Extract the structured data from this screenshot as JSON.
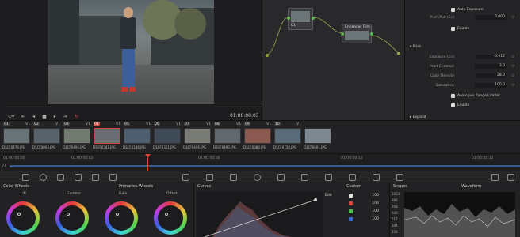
{
  "viewer": {
    "timecode": "01:00:00:03",
    "transport": [
      "⊙▾",
      "⇤",
      "◂",
      "■",
      "▸",
      "⇥",
      "↻"
    ]
  },
  "node_editor": {
    "nodes": [
      {
        "label": "01",
        "name": "node-01"
      },
      {
        "label": "Enhancer Film ...",
        "name": "enhancer-film-node"
      }
    ]
  },
  "inspector": {
    "checks": [
      {
        "label": "Auto Exposure"
      },
      {
        "label": "Enable"
      },
      {
        "label": "Analogue Range Limiter"
      },
      {
        "label": "Enable"
      }
    ],
    "rows": [
      {
        "label": "Push/Pull (Ev)",
        "value": "0.000"
      },
      {
        "label": "Exposure (Ev)",
        "value": "-0.612"
      },
      {
        "label": "Print Contrast",
        "value": "3.0"
      },
      {
        "label": "Color Density",
        "value": "28.0"
      },
      {
        "label": "Saturation",
        "value": "100.0"
      }
    ],
    "sections": {
      "print": "Print",
      "expand": "Expand"
    }
  },
  "clips": [
    {
      "num": "01",
      "track": "V1",
      "name": "DSCF0476.JPG",
      "color": "#6a7478"
    },
    {
      "num": "02",
      "track": "V1",
      "name": "DSCF0003.JPG",
      "color": "#59626a"
    },
    {
      "num": "03",
      "track": "V1",
      "name": "DSCF0406.JPG",
      "color": "#727a72"
    },
    {
      "num": "04",
      "track": "V1",
      "name": "DSCF0381.JPG",
      "color": "#6c6e74",
      "active": true
    },
    {
      "num": "05",
      "track": "V1",
      "name": "DSCF0186.JPG",
      "color": "#4f5e6e"
    },
    {
      "num": "06",
      "track": "V1",
      "name": "DSCF0321.JPG",
      "color": "#3e4a55"
    },
    {
      "num": "07",
      "track": "V1",
      "name": "DSCF0406.JPG",
      "color": "#7a7c78"
    },
    {
      "num": "08",
      "track": "V1",
      "name": "DSCF0490.JPG",
      "color": "#61686e"
    },
    {
      "num": "09",
      "track": "V1",
      "name": "DSCF0380.JPG",
      "color": "#8a5a52"
    },
    {
      "num": "10",
      "track": "V1",
      "name": "DSCF0720.JPG",
      "color": "#5b6a78"
    },
    {
      "num": "",
      "track": "",
      "name": "DSCF0601.JPG",
      "color": "#7d8890"
    }
  ],
  "timeline": {
    "track": "V1",
    "ticks": [
      "01:00:00:00",
      "01:00:00:03",
      "01:00:00:06",
      "01:00:00:10",
      "01:00:00:12"
    ]
  },
  "color_wheels": {
    "title": "Color Wheels",
    "mode": "Primaries Wheels",
    "wheels": [
      "Lift",
      "Gamma",
      "Gain",
      "Offset"
    ]
  },
  "curves": {
    "title": "Curves",
    "mode": "Custom",
    "edit_label": "Edit",
    "channels": [
      {
        "color": "#e0e0e0",
        "value": "100"
      },
      {
        "color": "#d9453a",
        "value": "100"
      },
      {
        "color": "#4cc24c",
        "value": "100"
      },
      {
        "color": "#3f6fd6",
        "value": "100"
      }
    ]
  },
  "scopes": {
    "title": "Scopes",
    "mode": "Waveform",
    "ticks": [
      "1023",
      "896",
      "768",
      "640",
      "512",
      "384",
      "256"
    ]
  }
}
